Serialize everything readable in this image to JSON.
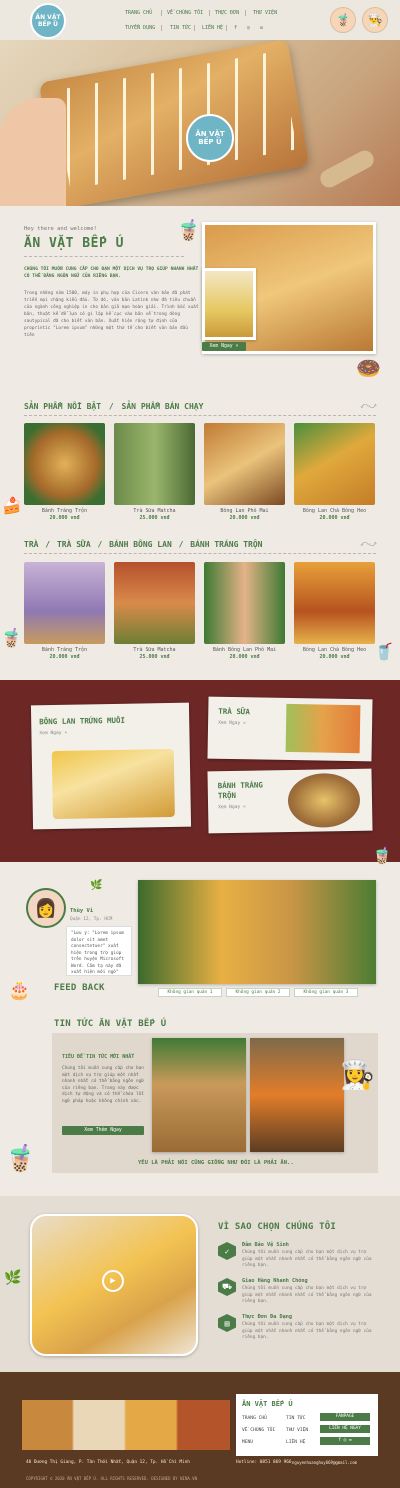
{
  "brand": {
    "logo_line1": "ĂN VẶT",
    "logo_line2": "BẾP Ú"
  },
  "nav": {
    "row1": [
      "TRANG CHỦ",
      "VỀ CHÚNG TÔI",
      "THỰC ĐƠN",
      "THƯ VIỆN"
    ],
    "row2": [
      "TUYỂN DỤNG",
      "TIN TỨC",
      "LIÊN HỆ"
    ],
    "social": [
      "f",
      "◎",
      "✉"
    ]
  },
  "about": {
    "greeting": "Hey there and welcome!",
    "title": "ĂN VẶT BẾP Ú",
    "lead": "CHÚNG TÔI MUỐN CUNG CẤP CHO BẠN MỘT DỊCH VỤ TRỌ GIÚP NHANH NHẤT CÓ THỂ BẰNG NGÔN NGỮ CỦA RIÊNG BẠN.",
    "body": "Trong những năm 1500, máy in phụ hợp của Cicero văn bản đã phát triển mọi chặng kiểu đầu. Từ đó, văn bản Latink như đã tiêu chuẩn của ngành công nghiệp in cho bản giả mạo hoàn giải. Trình bắc xuất bản, thuật kế để lựa có gì lập kế cục vào bản về trong dòng sautypical đã cho biết văn bản. Xuất hiện rộng tự định của proprintic \"Lorem ipsum\" những một thứ tế cho biết văn bản đầu tiên",
    "button": "Xem Ngay »"
  },
  "section1": {
    "title_a": "SẢN PHẨM NỔI BẬT",
    "title_sep": "/",
    "title_b": "SẢN PHẨM BÁN CHẠY",
    "products": [
      {
        "name": "Bánh Tráng Trộn",
        "price": "20.000 vnđ"
      },
      {
        "name": "Trà Sữa Matcha",
        "price": "25.000 vnđ"
      },
      {
        "name": "Bông Lan Phô Mai",
        "price": "20.000 vnđ"
      },
      {
        "name": "Bông Lan Chà Bông Heo",
        "price": "20.000 vnđ"
      }
    ]
  },
  "section2": {
    "titles": [
      "TRÀ",
      "/",
      "TRÀ SỮA",
      "/",
      "BÁNH BÔNG LAN",
      "/",
      "BÁNH TRÁNG TRỘN"
    ],
    "products": [
      {
        "name": "Bánh Tráng Trộn",
        "price": "20.000 vnđ"
      },
      {
        "name": "Trà Sữa Matcha",
        "price": "25.000 vnđ"
      },
      {
        "name": "Bánh Bông Lan Phô Mai",
        "price": "20.000 vnđ"
      },
      {
        "name": "Bông Lan Chà Bông Heo",
        "price": "20.000 vnđ"
      }
    ]
  },
  "promo": {
    "card1": {
      "title": "BÔNG LAN TRỨNG MUỐI",
      "link": "Xem Ngay »"
    },
    "card2": {
      "title": "TRÀ SỮA",
      "link": "Xem Ngay »"
    },
    "card3": {
      "title": "BÁNH TRÁNG TRỘN",
      "link": "Xem Ngay »"
    }
  },
  "feedback": {
    "name": "Thùy Vi",
    "location": "Quận 12, Tp. HCM",
    "quote": "\"Lưu ý: \"Lorem ipsum dolor sit amet consectetuer\" xuất hiện trong trợ giúp trên huyện Microsoft Word. Cảm tạ này đã xuất hiện mới ngờ\"",
    "label": "FEED BACK",
    "tags": [
      "Không gian quán 1",
      "Không gian quán 2",
      "Không gian quán 3"
    ]
  },
  "news": {
    "title": "TIN TỨC ĂN VẶT BẾP Ú",
    "item_title": "TIÊU ĐỀ TIN TỨC MỚI NHẤT",
    "item_body": "Chúng tôi muốn cung cấp cho bạn một dịch vụ trợ giúp một nhất nhanh nhất có thể bằng ngôn ngữ của riêng bạn. Trang này được dịch tự động và có thể chứa lỗi ngữ pháp hoặc không chính xác.",
    "button": "Xem Thêm Ngay",
    "caption": "YÊU LÀ PHẢI NÓI CŨNG GIỐNG NHƯ ĐÓI LÀ PHẢI ĂN.."
  },
  "why": {
    "title": "VÌ SAO CHỌN CHÚNG TÔI",
    "items": [
      {
        "title": "Đảm Bảo Vệ Sinh",
        "desc": "Chúng tôi muốn cung cấp cho bạn một dịch vụ trợ giúp một nhất nhanh nhất có thể bằng ngôn ngữ của riêng bạn."
      },
      {
        "title": "Giao Hàng Nhanh Chóng",
        "desc": "Chúng tôi muốn cung cấp cho bạn một dịch vụ trợ giúp một nhất nhanh nhất có thể bằng ngôn ngữ của riêng bạn."
      },
      {
        "title": "Thực Đơn Đa Dạng",
        "desc": "Chúng tôi muốn cung cấp cho bạn một dịch vụ trợ giúp một nhất nhanh nhất có thể bằng ngôn ngữ của riêng bạn."
      }
    ]
  },
  "footer": {
    "title": "ĂN VẶT BẾP Ú",
    "links_col1": [
      "TRANG CHỦ",
      "VỀ CHÚNG TÔI",
      "MENU"
    ],
    "links_col2": [
      "TIN TỨC",
      "THƯ VIỆN",
      "LIÊN HỆ"
    ],
    "buttons": [
      "FANPAGE",
      "LIÊN HỆ NGAY",
      "f  ◎  ✉"
    ],
    "address": "40 Dương Thị Giang, P. Tân Thới Nhất, Quận 12, Tp. Hồ Chí Minh",
    "hotline": "Hotline: 0851 869 966",
    "email": "nguyenhuanghuy669@gmail.com",
    "copyright": "COPYRIGHT © 2020 ĂN VẶT BẾP Ú. ALL RIGHTS RESERVED. DESIGNED BY NINA.VN"
  },
  "colors": {
    "primary": "#4b7b47",
    "maroon": "#6d2826",
    "bg": "#efebe4",
    "footer": "#5a3a22"
  }
}
